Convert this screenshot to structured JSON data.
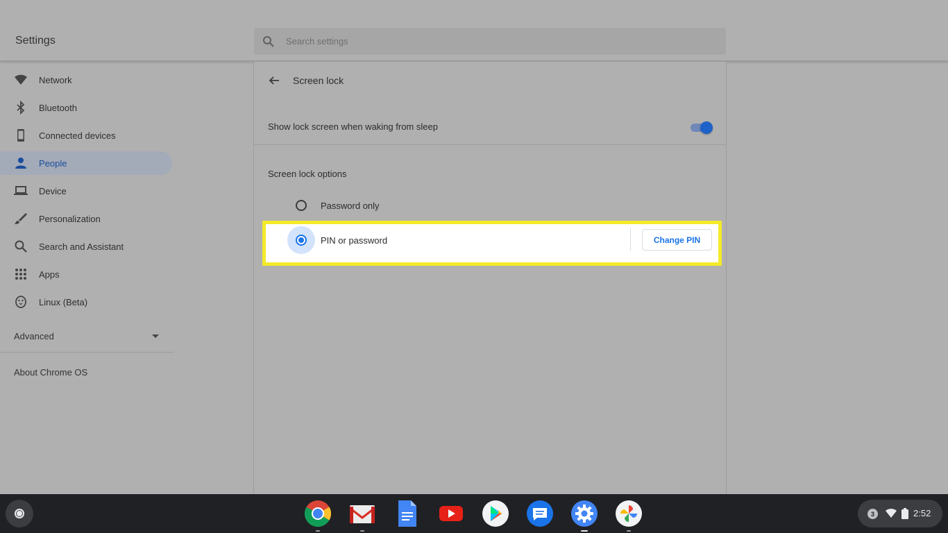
{
  "window": {
    "controls": [
      "minimize-icon",
      "maximize-icon",
      "close-icon"
    ]
  },
  "header": {
    "title": "Settings",
    "search_placeholder": "Search settings"
  },
  "sidebar": {
    "items": [
      {
        "label": "Network",
        "icon": "wifi-icon"
      },
      {
        "label": "Bluetooth",
        "icon": "bluetooth-icon"
      },
      {
        "label": "Connected devices",
        "icon": "phone-icon"
      },
      {
        "label": "People",
        "icon": "person-icon",
        "active": true
      },
      {
        "label": "Device",
        "icon": "laptop-icon"
      },
      {
        "label": "Personalization",
        "icon": "brush-icon"
      },
      {
        "label": "Search and Assistant",
        "icon": "search-icon"
      },
      {
        "label": "Apps",
        "icon": "apps-grid-icon"
      },
      {
        "label": "Linux (Beta)",
        "icon": "linux-penguin-icon"
      }
    ],
    "advanced_label": "Advanced",
    "about_label": "About Chrome OS"
  },
  "main": {
    "title": "Screen lock",
    "toggle_row": {
      "label": "Show lock screen when waking from sleep",
      "enabled": true
    },
    "section_label": "Screen lock options",
    "options": [
      {
        "label": "Password only",
        "selected": false
      },
      {
        "label": "PIN or password",
        "selected": true
      }
    ],
    "change_pin_label": "Change PIN"
  },
  "shelf": {
    "apps": [
      "chrome-icon",
      "gmail-icon",
      "docs-icon",
      "youtube-icon",
      "play-store-icon",
      "messages-icon",
      "settings-icon",
      "photos-icon"
    ],
    "active_app": "settings-icon",
    "notification_count": "3",
    "time": "2:52"
  },
  "colors": {
    "accent": "#1a73e8",
    "highlight_border": "#f4ea2a",
    "shelf": "#202124"
  }
}
